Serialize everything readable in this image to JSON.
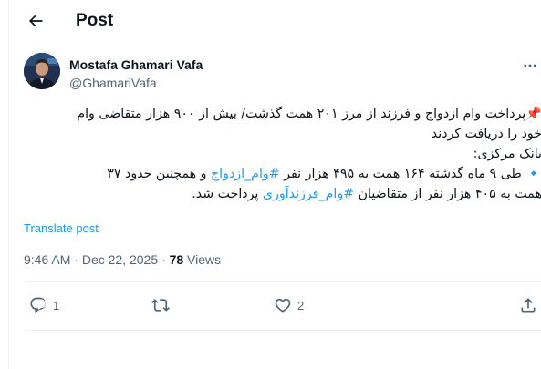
{
  "header": {
    "back_icon": "arrow-left-icon",
    "title": "Post"
  },
  "author": {
    "name": "Mostafa Ghamari Vafa",
    "handle": "@GhamariVafa",
    "avatar_icon": "profile-photo"
  },
  "tweet": {
    "lines": [
      {
        "parts": [
          {
            "t": "📌پرداخت وام ازدواج و فرزند از مرز ۲۰۱ همت گذشت/ بیش از ۹۰۰ هزار متقاضی وام"
          }
        ]
      },
      {
        "parts": [
          {
            "t": "خود را دریافت کردند"
          }
        ]
      },
      {
        "parts": [
          {
            "t": "بانک مرکزی:"
          }
        ]
      },
      {
        "parts": [
          {
            "t": "🔹 طی ۹ ماه گذشته ۱۶۴ همت به ۴۹۵ هزار نفر "
          },
          {
            "t": "#وام_ازدواج",
            "tag": true
          },
          {
            "t": " و همچنین حدود ۳۷"
          }
        ]
      },
      {
        "parts": [
          {
            "t": "همت به ۴۰۵ هزار نفر از متقاضیان "
          },
          {
            "t": "#وام_فرزندآوری",
            "tag": true
          },
          {
            "t": " پرداخت شد."
          }
        ]
      }
    ]
  },
  "translate_label": "Translate post",
  "meta": {
    "time": "9:46 AM",
    "separator": " · ",
    "date": "Dec 22, 2025",
    "views_count": "78",
    "views_label": " Views"
  },
  "actions": {
    "reply_count": "1",
    "repost_count": "",
    "like_count": "2",
    "share_count": ""
  },
  "colors": {
    "link": "#1d9bf0",
    "secondary": "#536471",
    "divider": "#eff3f4"
  }
}
